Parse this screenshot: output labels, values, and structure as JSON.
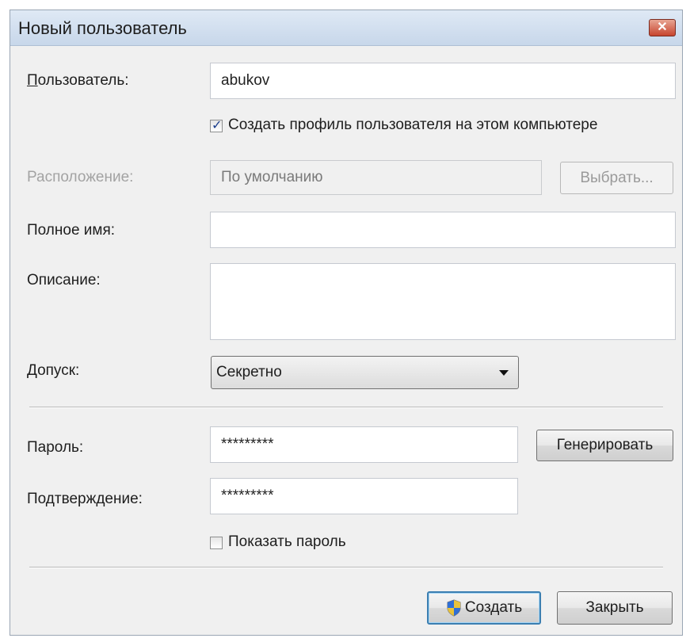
{
  "window": {
    "title": "Новый пользователь"
  },
  "form": {
    "user_label": "Пользователь:",
    "user_value": "abukov",
    "create_profile_label": "Создать профиль пользователя на этом компьютере",
    "create_profile_checked": true,
    "location_label": "Расположение:",
    "location_value": "По умолчанию",
    "browse_button": "Выбрать...",
    "fullname_label": "Полное имя:",
    "fullname_value": "",
    "description_label": "Описание:",
    "description_value": "",
    "clearance_label": "Допуск:",
    "clearance_value": "Секретно",
    "password_label": "Пароль:",
    "password_value": "*********",
    "generate_button": "Генерировать",
    "confirm_label": "Подтверждение:",
    "confirm_value": "*********",
    "show_password_label": "Показать пароль",
    "show_password_checked": false
  },
  "buttons": {
    "create": "Создать",
    "close": "Закрыть"
  },
  "icons": {
    "close": "close-icon",
    "shield": "uac-shield-icon",
    "dropdown": "chevron-down-icon"
  },
  "colors": {
    "title_gradient_top": "#dfe9f5",
    "close_button": "#c7452f",
    "default_button_border": "#3c7fb1"
  }
}
